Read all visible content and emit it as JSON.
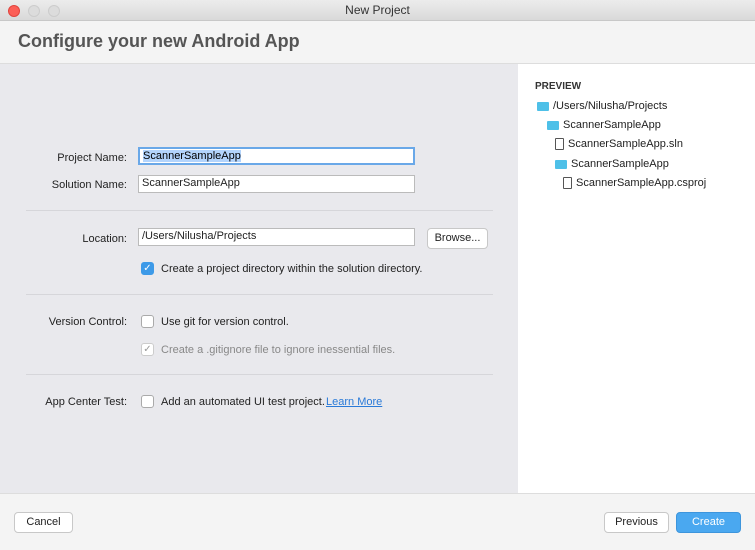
{
  "window": {
    "title": "New Project"
  },
  "header": {
    "title": "Configure your new Android App"
  },
  "form": {
    "project_name_label": "Project Name:",
    "project_name_value": "ScannerSampleApp",
    "solution_name_label": "Solution Name:",
    "solution_name_value": "ScannerSampleApp",
    "location_label": "Location:",
    "location_value": "/Users/Nilusha/Projects",
    "browse_label": "Browse...",
    "create_dir_label": "Create a project directory within the solution directory.",
    "create_dir_checked": true,
    "version_control_label": "Version Control:",
    "use_git_label": "Use git for version control.",
    "use_git_checked": false,
    "gitignore_label": "Create a .gitignore file to ignore inessential files.",
    "gitignore_checked": true,
    "app_center_label": "App Center Test:",
    "ui_test_label": "Add an automated UI test project.",
    "learn_more": "Learn More",
    "ui_test_checked": false
  },
  "preview": {
    "title": "PREVIEW",
    "items": [
      {
        "type": "folder",
        "name": "/Users/Nilusha/Projects"
      },
      {
        "type": "folder",
        "name": "ScannerSampleApp"
      },
      {
        "type": "file",
        "name": "ScannerSampleApp.sln"
      },
      {
        "type": "folder",
        "name": "ScannerSampleApp"
      },
      {
        "type": "file",
        "name": "ScannerSampleApp.csproj"
      }
    ]
  },
  "footer": {
    "cancel": "Cancel",
    "previous": "Previous",
    "create": "Create"
  },
  "colors": {
    "accent": "#4aa8f0",
    "link": "#2a7ad8",
    "folder": "#4ec0e8"
  }
}
